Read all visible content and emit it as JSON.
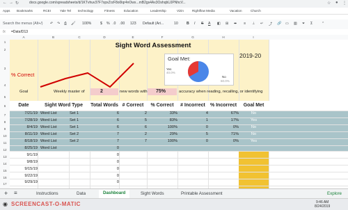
{
  "browser": {
    "url": "docs.google.com/spreadsheets/d/1KTvhuv37F7xpxZrzF8o0lqr4nOwx...mB2gs4Ax3OshqbUJPNhcV...",
    "bookmarks": [
      "Apps",
      "Bookmarks",
      "RCEI",
      "Yale Tel",
      "technology",
      "Fitness",
      "Education",
      "Leadership",
      "Vizin",
      "Rightflow Media",
      "Vacation",
      "Church"
    ]
  },
  "menus": {
    "search_placeholder": "Search the menus (Alt+/)",
    "items": [
      "Search the menus (Alt+/)"
    ]
  },
  "toolbar": {
    "zoom": "100%",
    "currency": "$",
    "percent": "%",
    "decimals": ".0",
    "decimals2": ".00",
    "format": "123",
    "font": "Default (Ari...",
    "size": "10",
    "bold": "B",
    "italic": "I",
    "strike": "S",
    "textcolor": "A"
  },
  "formula_bar": {
    "fx": "fx",
    "value": "=Data!D13"
  },
  "columns": [
    "A",
    "B",
    "C",
    "D",
    "E",
    "F",
    "G",
    "H",
    "I"
  ],
  "rows": [
    "1",
    "2",
    "3",
    "4",
    "5",
    "6",
    "7",
    "8",
    "9",
    "10",
    "11",
    "12",
    "13",
    "14",
    "15",
    "16",
    "17",
    "18"
  ],
  "dashboard": {
    "title": "Sight Word Assessment",
    "year": "2019-20",
    "percent_correct_label": "% Correct",
    "goal_label": "Goal",
    "goal_sentence_1": "Weekly master of",
    "goal_words": "2",
    "goal_sentence_2": "new words with",
    "goal_accuracy": "75%",
    "goal_sentence_3": "accuracy when reading, recalling, or identifying",
    "goal_met_chart": {
      "title": "Goal Met:",
      "yes_label": "Yes",
      "yes_pct": "40.0%",
      "no_label": "No",
      "no_pct": "60.0%",
      "yes_color": "#e53935",
      "no_color": "#4a86e8"
    },
    "table_headers": [
      "Date",
      "Sight Word Type",
      "Total Words",
      "# Correct",
      "% Correct",
      "# Incorrect",
      "% Incorrect",
      "Goal Met"
    ],
    "table_rows": [
      [
        "7/21/19",
        "Word List",
        "Set 1",
        "6",
        "2",
        "33%",
        "4",
        "67%",
        "No"
      ],
      [
        "7/28/19",
        "Word List",
        "Set 1",
        "6",
        "5",
        "83%",
        "1",
        "17%",
        "Yes"
      ],
      [
        "8/4/19",
        "Word List",
        "Set 1",
        "6",
        "6",
        "100%",
        "0",
        "0%",
        "No"
      ],
      [
        "8/11/19",
        "Word List",
        "Set 2",
        "7",
        "2",
        "29%",
        "5",
        "71%",
        "No"
      ],
      [
        "8/18/19",
        "Word List",
        "Set 2",
        "7",
        "7",
        "100%",
        "0",
        "0%",
        "Yes"
      ],
      [
        "8/25/19",
        "Word List",
        "",
        "0",
        "",
        "",
        "",
        "",
        ""
      ],
      [
        "9/1/19",
        "",
        "",
        "0",
        "",
        "",
        "",
        "",
        ""
      ],
      [
        "9/8/19",
        "",
        "",
        "0",
        "",
        "",
        "",
        "",
        ""
      ],
      [
        "9/15/19",
        "",
        "",
        "0",
        "",
        "",
        "",
        "",
        ""
      ],
      [
        "9/22/19",
        "",
        "",
        "0",
        "",
        "",
        "",
        "",
        ""
      ],
      [
        "9/29/19",
        "",
        "",
        "0",
        "",
        "",
        "",
        "",
        ""
      ]
    ]
  },
  "tabs": [
    "Instructions",
    "Data",
    "Dashboard",
    "Sight Words",
    "Printable Assessment"
  ],
  "active_tab": "Dashboard",
  "explore_label": "Explore",
  "taskbar": {
    "watermark": "SCREENCAST-O-MATIC",
    "time": "9:46 AM",
    "date": "8/24/2019"
  }
}
